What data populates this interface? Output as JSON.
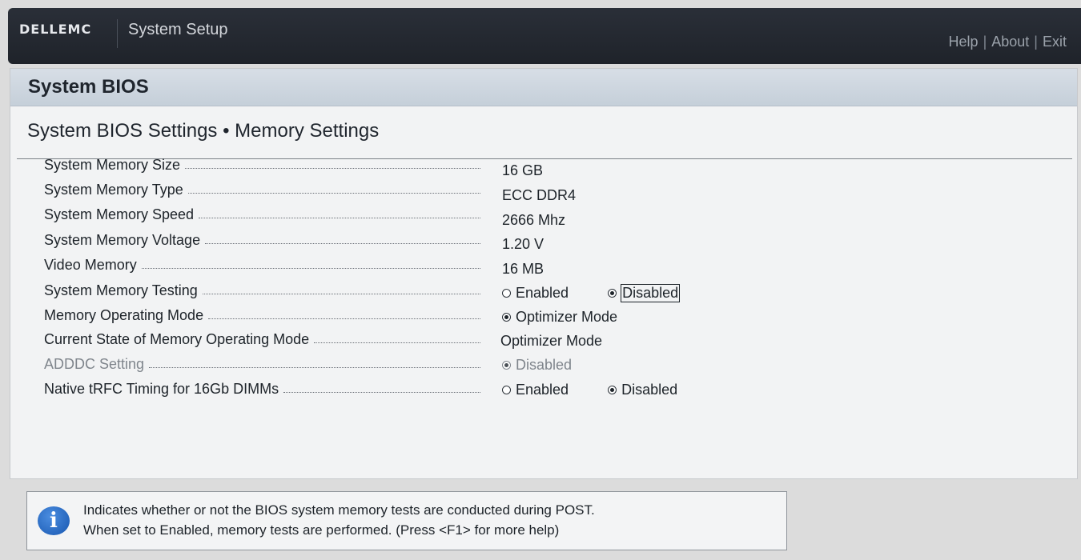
{
  "header": {
    "brand": "DELLEMC",
    "title": "System Setup",
    "links": [
      "Help",
      "About",
      "Exit"
    ]
  },
  "panel": {
    "title": "System BIOS",
    "subtitle": "System BIOS Settings • Memory Settings"
  },
  "settings": [
    {
      "label": "System Memory Size",
      "value": "16 GB"
    },
    {
      "label": "System Memory Type",
      "value": "ECC DDR4"
    },
    {
      "label": "System Memory Speed",
      "value": "2666 Mhz"
    },
    {
      "label": "System Memory Voltage",
      "value": "1.20 V"
    },
    {
      "label": "Video Memory",
      "value": "16 MB"
    },
    {
      "label": "System Memory Testing",
      "options": [
        "Enabled",
        "Disabled"
      ],
      "selected": "Disabled"
    },
    {
      "label": "Memory Operating Mode",
      "options": [
        "Optimizer Mode"
      ],
      "selected": "Optimizer Mode"
    },
    {
      "label": "Current State of Memory Operating Mode",
      "value": "Optimizer Mode"
    },
    {
      "label": "ADDDC Setting",
      "options": [
        "Disabled"
      ],
      "selected": "Disabled",
      "disabled": true
    },
    {
      "label": "Native tRFC Timing for 16Gb DIMMs",
      "options": [
        "Enabled",
        "Disabled"
      ],
      "selected": "Disabled"
    }
  ],
  "help": {
    "icon": "info-icon",
    "line1": "Indicates whether or not the BIOS system memory tests are conducted during POST.",
    "line2": "When set to Enabled, memory tests are performed. (Press <F1> for more help)"
  }
}
